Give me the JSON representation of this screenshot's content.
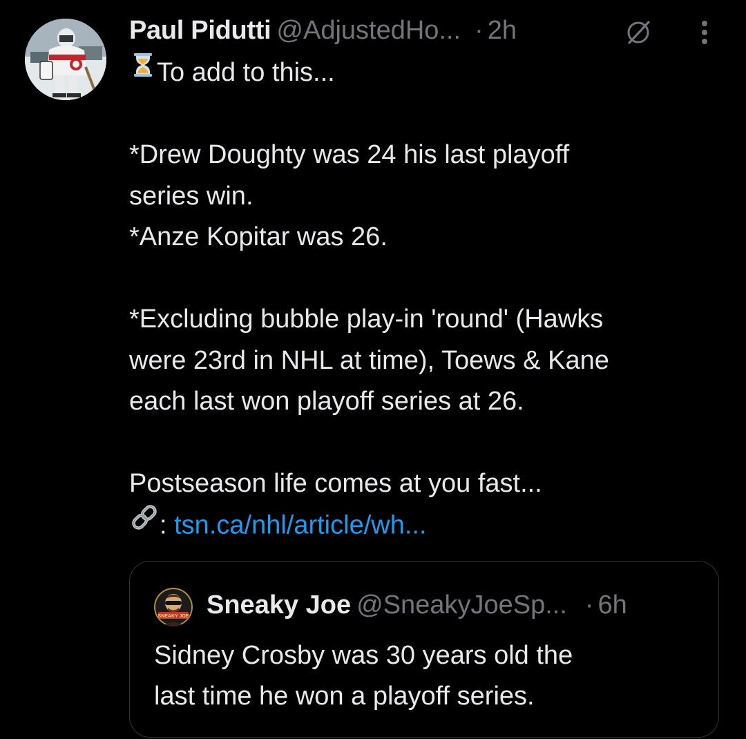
{
  "tweet": {
    "author_name": "Paul Pidutti",
    "author_handle": "@AdjustedHo...",
    "separator": "·",
    "time": "2h",
    "edited_icon": "edited-pencil-icon",
    "more_icon": "more-vertical-icon",
    "lines": {
      "l1": "To add to this...",
      "l3": "*Drew Doughty was 24 his last playoff",
      "l4": "series win.",
      "l5": "*Anze Kopitar was 26.",
      "l7": "*Excluding bubble play-in 'round' (Hawks",
      "l8": "were 23rd in NHL at time), Toews & Kane",
      "l9": "each last won playoff series at 26.",
      "l11": "Postseason life comes at you fast...",
      "link_prefix": ": ",
      "link_text": "tsn.ca/nhl/article/wh..."
    },
    "emojis": {
      "hourglass": "hourglass-icon",
      "link": "link-icon"
    },
    "colors": {
      "background": "#000000",
      "text": "#e7e9ea",
      "muted": "#71767b",
      "link": "#1d9bf0",
      "border": "#2f3336"
    }
  },
  "quote": {
    "author_name": "Sneaky Joe",
    "author_handle": "@SneakyJoeSp...",
    "separator": "·",
    "time": "6h",
    "avatar_logo_text": "SNEAKY JOE",
    "text_lines": {
      "q1": "Sidney Crosby was 30 years old the",
      "q2": "last time he won a playoff series."
    }
  }
}
